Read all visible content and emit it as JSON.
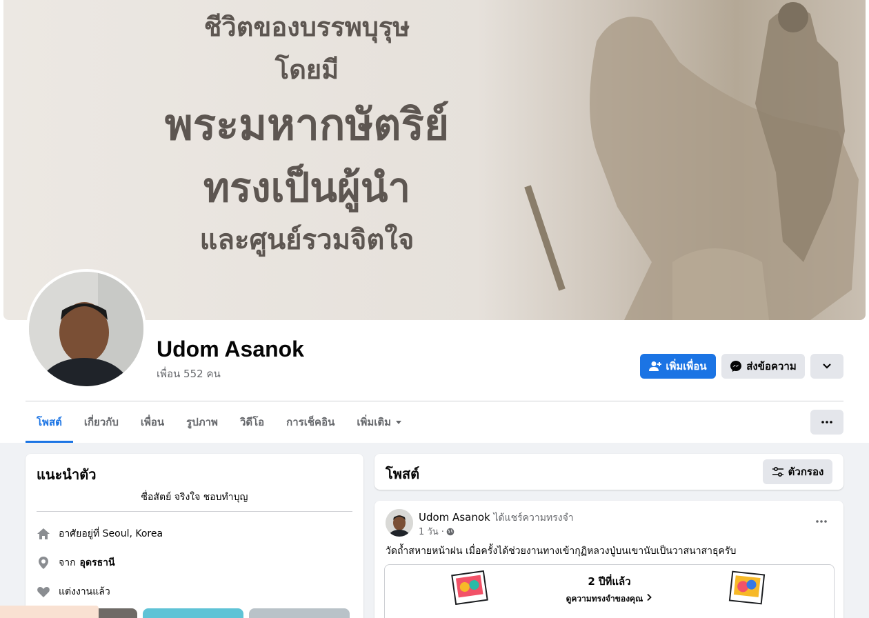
{
  "cover": {
    "lines": [
      "ชีวิตของบรรพบุรุษ",
      "โดยมี",
      "พระมหากษัตริย์",
      "ทรงเป็นผู้นำ",
      "และศูนย์รวมจิตใจ"
    ]
  },
  "profile": {
    "name": "Udom Asanok",
    "friends": "เพื่อน 552 คน",
    "add_friend": "เพิ่มเพื่อน",
    "message": "ส่งข้อความ"
  },
  "tabs": [
    "โพสต์",
    "เกี่ยวกับ",
    "เพื่อน",
    "รูปภาพ",
    "วิดีโอ",
    "การเช็คอิน",
    "เพิ่มเติม"
  ],
  "intro": {
    "title": "แนะนำตัว",
    "bio": "ซื่อสัตย์ จริงใจ ชอบทำบุญ",
    "lives": "อาศัยอยู่ที่ Seoul, Korea",
    "from_prefix": "จาก",
    "from_place": "อุดรธานี",
    "relationship": "แต่งงานแล้ว"
  },
  "posts": {
    "title": "โพสต์",
    "filter": "ตัวกรอง",
    "post1": {
      "author": "Udom Asanok",
      "action": "ได้แชร์ความทรงจำ",
      "time": "1 วัน ·",
      "text": "วัดถ้ำสหายหน้าฝน เมื่อครั้งได้ช่วยงานทางเข้ากุฏิหลวงปู่บนเขานับเป็นวาสนาสาธุครับ",
      "memory_years": "2 ปีที่แล้ว",
      "memory_link": "ดูความทรงจำของคุณ"
    }
  },
  "colors": {
    "accent": "#1b74e4",
    "bg": "#f0f2f5",
    "muted": "#65676b"
  }
}
